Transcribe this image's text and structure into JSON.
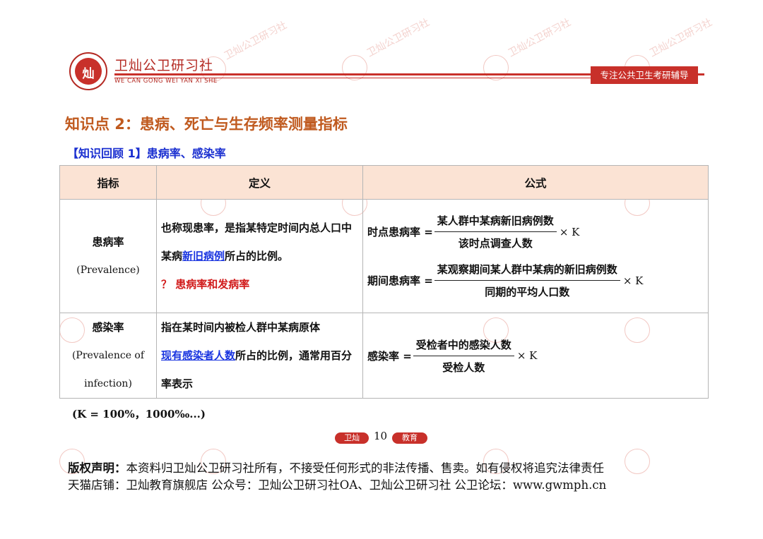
{
  "header": {
    "brand_cn": "卫灿公卫研习社",
    "brand_en": "WE CAN GONG WEI YAN XI SHE",
    "logo_glyph": "灿",
    "tagline": "专注公共卫生考研辅导"
  },
  "watermark_text": "卫灿公卫研习社",
  "section_title": "知识点 2：患病、死亡与生存频率测量指标",
  "review_title": "【知识回顾 1】患病率、感染率",
  "table": {
    "headers": [
      "指标",
      "定义",
      "公式"
    ],
    "rows": [
      {
        "indicator_cn": "患病率",
        "indicator_en": "(Prevalence)",
        "def_part1": "也称现患率，是指某特定时间内总人口中某病",
        "def_link": "新旧病例",
        "def_part2": "所占的比例。",
        "def_question": "？ 患病率和发病率",
        "formulas": [
          {
            "label": "时点患病率 =",
            "numerator": "某人群中某病新旧病例数",
            "denominator": "该时点调查人数",
            "multiplier": "× K"
          },
          {
            "label": "期间患病率 =",
            "numerator": "某观察期间某人群中某病的新旧病例数",
            "denominator": "同期的平均人口数",
            "multiplier": "× K"
          }
        ]
      },
      {
        "indicator_cn": "感染率",
        "indicator_en_line1": "(Prevalence of",
        "indicator_en_line2": "infection)",
        "def_part1": "指在某时间内被检人群中某病原体",
        "def_link": "现有感染者人数",
        "def_part2": "所占的比例，通常用百分率表示",
        "formulas": [
          {
            "label": "感染率 =",
            "numerator": "受检者中的感染人数",
            "denominator": "受检人数",
            "multiplier": "× K"
          }
        ]
      }
    ]
  },
  "note": "(K = 100%，1000‰...)",
  "page": {
    "left_label": "卫灿",
    "number": "10",
    "right_label": "教育"
  },
  "footer": {
    "copyright_label": "版权声明：",
    "copyright_text": "本资料归卫灿公卫研习社所有，不接受任何形式的非法传播、售卖。如有侵权将追究法律责任",
    "contact": "天猫店铺：卫灿教育旗舰店  公众号：卫灿公卫研习社OA、卫灿公卫研习社  公卫论坛：www.gwmph.cn"
  },
  "colors": {
    "brand_red": "#c8302a",
    "title_orange": "#c05a1f",
    "review_blue": "#1a2fd0",
    "link_blue": "#1a35e0",
    "header_fill": "#fbe3d4"
  }
}
